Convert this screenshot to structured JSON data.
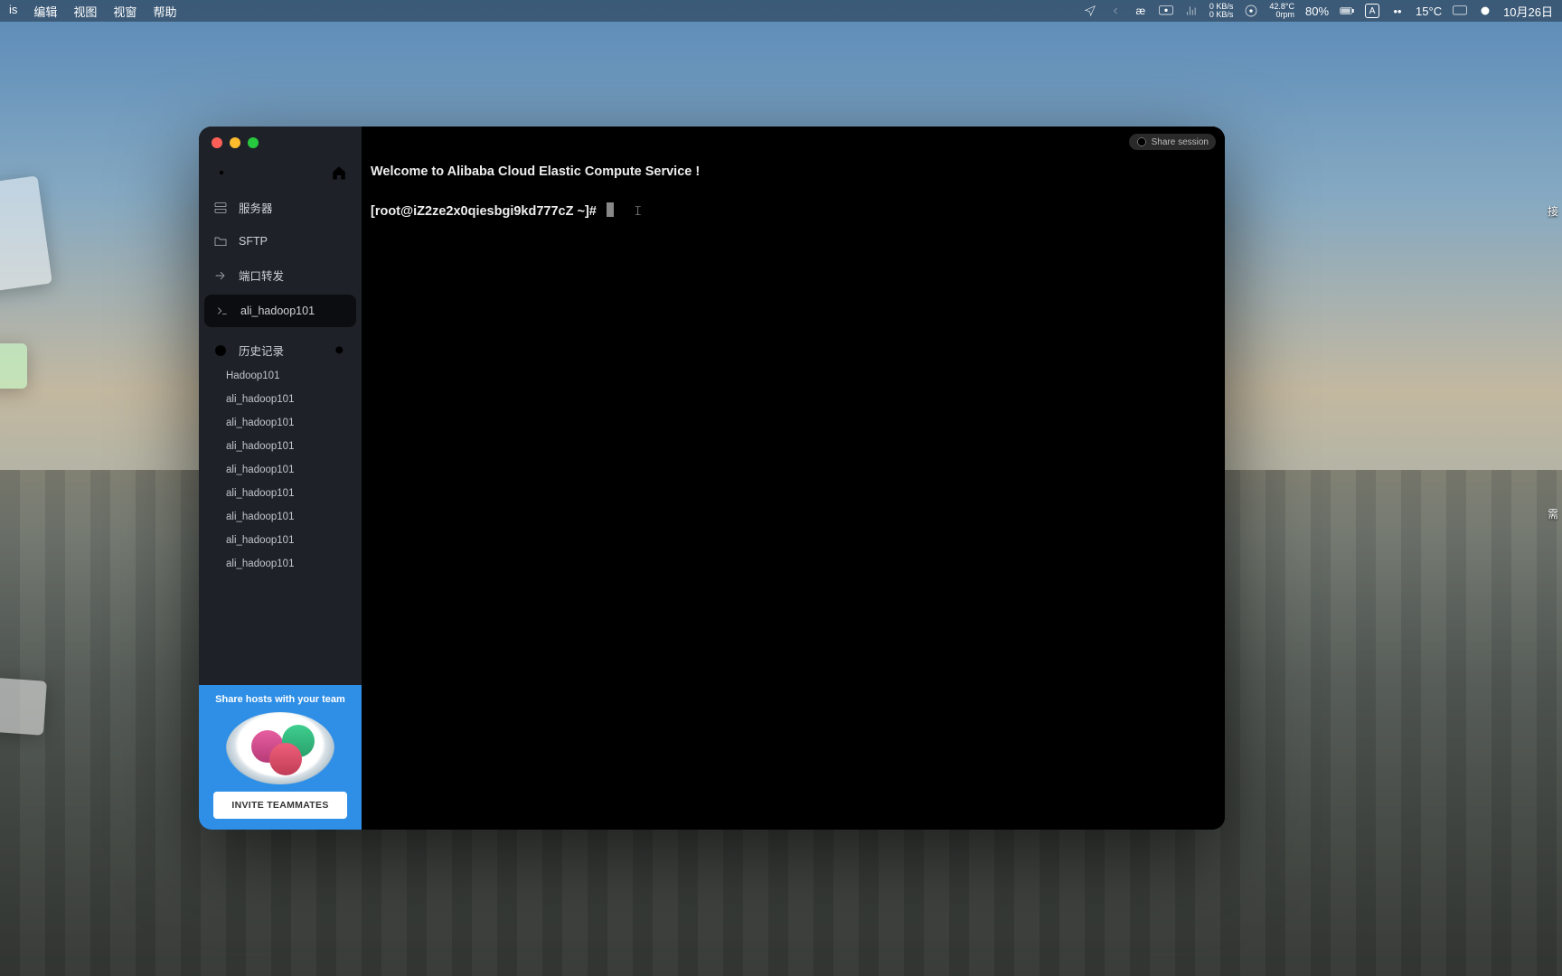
{
  "menubar": {
    "left": [
      "is",
      "编辑",
      "视图",
      "视窗",
      "帮助"
    ],
    "net_up": "0 KB/s",
    "net_down": "0 KB/s",
    "temp": "42.8°C",
    "rpm": "0rpm",
    "battery": "80%",
    "input_mode": "A",
    "weather": "15°C",
    "date": "10月26日"
  },
  "app": {
    "share_label": "Share session",
    "nav": {
      "servers": "服务器",
      "sftp": "SFTP",
      "port_fwd": "端口转发",
      "active_session": "ali_hadoop101",
      "history_label": "历史记录"
    },
    "history": [
      "Hadoop101",
      "ali_hadoop101",
      "ali_hadoop101",
      "ali_hadoop101",
      "ali_hadoop101",
      "ali_hadoop101",
      "ali_hadoop101",
      "ali_hadoop101",
      "ali_hadoop101"
    ],
    "promo": {
      "headline": "Share hosts with your team",
      "button": "INVITE TEAMMATES"
    },
    "terminal": {
      "welcome": "Welcome to Alibaba Cloud Elastic Compute Service !",
      "prompt": "[root@iZ2ze2x0qiesbgi9kd777cZ ~]#"
    }
  },
  "desktop": {
    "right_label_1": "接",
    "right_label_2": "需"
  }
}
